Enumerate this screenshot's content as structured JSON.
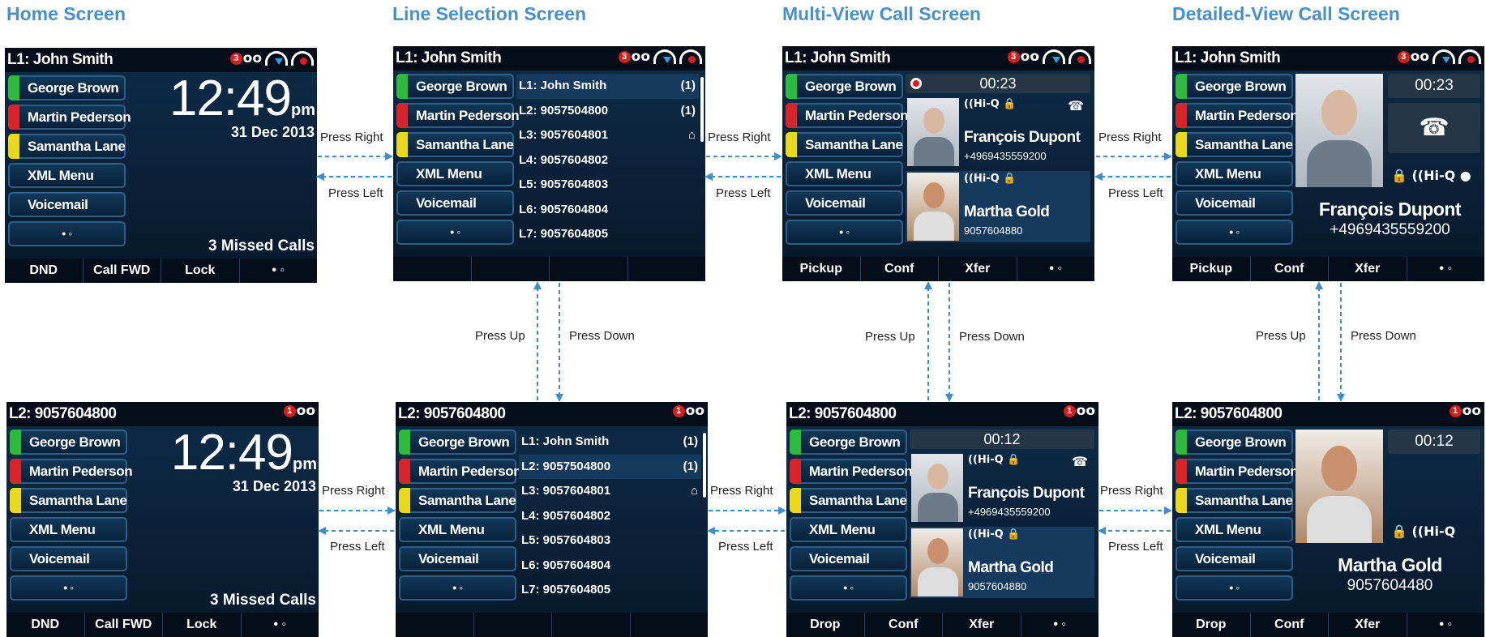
{
  "titles": {
    "home": "Home Screen",
    "line_selection": "Line Selection Screen",
    "multi_view": "Multi-View Call Screen",
    "detailed_view": "Detailed-View Call Screen"
  },
  "colors": {
    "title": "#4a90c8",
    "arrow": "#3b8fd0",
    "screen_bg": "#0b2038"
  },
  "status_icons": {
    "voicemail_badge": "1",
    "voicemail_glyph": "oo",
    "names": [
      "voicemail-icon",
      "call-forward-icon",
      "do-not-disturb-icon"
    ]
  },
  "line1_label": "L1: John Smith",
  "line2_label": "L2: 9057604800",
  "keys": [
    "George Brown",
    "Martin Pederson",
    "Samantha Lane",
    "XML Menu",
    "Voicemail",
    "• ◦"
  ],
  "home": {
    "time": "12:49",
    "ampm": "pm",
    "date": "31 Dec 2013",
    "missed": "3 Missed Calls",
    "softkeys": [
      "DND",
      "Call FWD",
      "Lock",
      "• ◦"
    ]
  },
  "line_selection": {
    "lines": [
      {
        "label": "L1: John Smith",
        "count": "(1)"
      },
      {
        "label": "L2: 9057504800",
        "count": "(1)"
      },
      {
        "label": "L3: 9057604801",
        "count": "⌂"
      },
      {
        "label": "L4: 9057604802",
        "count": ""
      },
      {
        "label": "L5: 9057604803",
        "count": ""
      },
      {
        "label": "L6: 9057604804",
        "count": ""
      },
      {
        "label": "L7: 9057604805",
        "count": ""
      }
    ]
  },
  "multi_view": {
    "top_timer": "00:23",
    "bottom_timer": "00:12",
    "hiq": "((Hi-Q 🔒",
    "caller1_name": "François Dupont",
    "caller1_number": "+4969435559200",
    "caller2_name": "Martha Gold",
    "caller2_number": "9057604880",
    "softkeys_top": [
      "Pickup",
      "Conf",
      "Xfer",
      "• ◦"
    ],
    "softkeys_bottom": [
      "Drop",
      "Conf",
      "Xfer",
      "• ◦"
    ]
  },
  "detailed_view": {
    "top_timer": "00:23",
    "bottom_timer": "00:12",
    "top_name": "François Dupont",
    "top_number": "+4969435559200",
    "bottom_name": "Martha Gold",
    "bottom_number": "9057604480",
    "top_icons": "🔒 ((Hi-Q ●",
    "bottom_icons": "🔒 ((Hi-Q",
    "softkeys_top": [
      "Pickup",
      "Conf",
      "Xfer",
      "• ◦"
    ],
    "softkeys_bottom": [
      "Drop",
      "Conf",
      "Xfer",
      "• ◦"
    ]
  },
  "nav_labels": {
    "right": "Press Right",
    "left": "Press Left",
    "up": "Press Up",
    "down": "Press Down"
  }
}
